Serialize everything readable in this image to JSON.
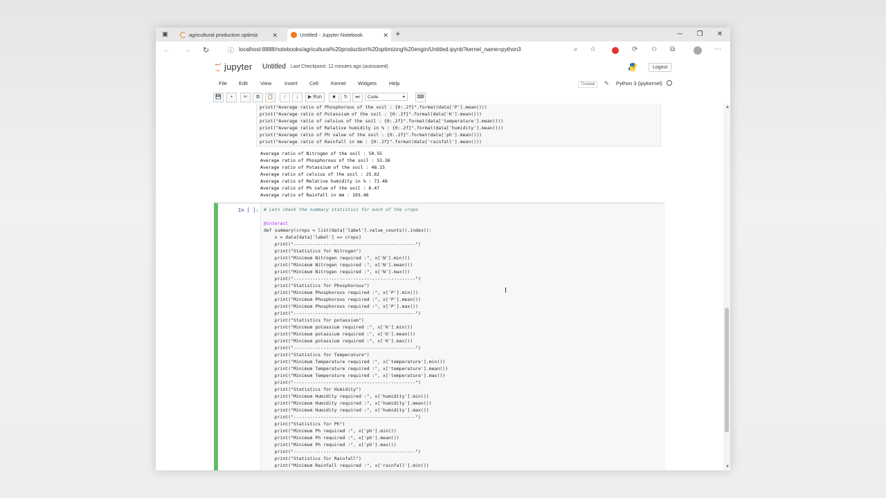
{
  "browser": {
    "tabs": [
      {
        "label": "agricultural production optimiz"
      },
      {
        "label": "Untitled - Jupyter Notebook"
      }
    ],
    "new_tab": "+",
    "url": "localhost:8888/notebooks/agricultural%20production%20optimizing%20engin/Untitled.ipynb?kernel_name=python3"
  },
  "jupyter": {
    "logo": "jupyter",
    "notebook_name": "Untitled",
    "checkpoint": "Last Checkpoint: 12 minutes ago  (autosaved)",
    "logout": "Logout",
    "menu": [
      "File",
      "Edit",
      "View",
      "Insert",
      "Cell",
      "Kernel",
      "Widgets",
      "Help"
    ],
    "trusted": "Trusted",
    "kernel": "Python 3 (ipykernel)",
    "toolbar": {
      "run": "Run",
      "cell_type": "Code"
    }
  },
  "cell1": {
    "code": [
      "print(\"Average ratio of Phosphorous of the soil : {0:.2f}\".format(data['P'].mean()))",
      "print(\"Average ratio of Potassium of the soil : {0:.2f}\".format(data['K'].mean()))",
      "print(\"Average ratio of celsius of the soil : {0:.2f}\".format(data['temperature'].mean()))",
      "print(\"Average ratio of Relative humidity in % : {0:.2f}\".format(data['humidity'].mean()))",
      "print(\"Average ratio of Ph value of the soil : {0:.2f}\".format(data['ph'].mean()))",
      "print(\"Average ratio of Rainfall in mm : {0:.2f}\".format(data['rainfall'].mean()))"
    ],
    "output": [
      "Average ratio of Nitrogen of the soil : 50.55",
      "Average ratio of Phosphorous of the soil : 53.36",
      "Average ratio of Potassium of the soil : 48.15",
      "Average ratio of celsius of the soil : 25.62",
      "Average ratio of Relative humidity in % : 71.48",
      "Average ratio of Ph value of the soil : 6.47",
      "Average ratio of Rainfall in mm : 103.46"
    ]
  },
  "cell2": {
    "prompt": "In [ ]:",
    "comment": "# Lets check the summary statistics for each of the crops",
    "code": [
      "",
      "@interact",
      "def summary(crops = list(data['label'].value_counts().index)):",
      "    x = data[data['label'] == crops]",
      "    print(\"---------------------------------------------\")",
      "    print(\"Statistics for Nitrogen\")",
      "    print(\"Minimum Nitrogen required :\", x['N'].min())",
      "    print(\"Minimum Nitrogen required :\", x['N'].mean())",
      "    print(\"Minimum Nitrogen required :\", x['N'].max())",
      "    print(\"---------------------------------------------\")",
      "    print(\"Statistics for Phosphorous\")",
      "    print(\"Minimum Phosphorous required :\", x['P'].min())",
      "    print(\"Minimum Phosphorous required :\", x['P'].mean())",
      "    print(\"Minimum Phosphorous required :\", x['P'].max())",
      "    print(\"---------------------------------------------\")",
      "    print(\"Statistics for potassium\")",
      "    print(\"Minimum potassium required :\", x['K'].min())",
      "    print(\"Minimum potassium required :\", x['K'].mean())",
      "    print(\"Minimum potassium required :\", x['K'].max())",
      "    print(\"---------------------------------------------\")",
      "    print(\"Statistics for Temperature\")",
      "    print(\"Minimum Temperature required :\", x['temperature'].min())",
      "    print(\"Minimum Temperature required :\", x['temperature'].mean())",
      "    print(\"Minimum Temperature required :\", x['temperature'].max())",
      "    print(\"---------------------------------------------\")",
      "    print(\"Statistics for Humidity\")",
      "    print(\"Minimum Humidity required :\", x['humidity'].min())",
      "    print(\"Minimum Humidity required :\", x['humidity'].mean())",
      "    print(\"Minimum Humidity required :\", x['humidity'].max())",
      "    print(\"---------------------------------------------\")",
      "    print(\"Statistics for Ph\")",
      "    print(\"Minimum Ph required :\", x['ph'].min())",
      "    print(\"Minimum Ph required :\", x['ph'].mean())",
      "    print(\"Minimum Ph required :\", x['ph'].max())",
      "    print(\"---------------------------------------------\")",
      "    print(\"Statistics for Rainfall\")",
      "    print(\"Minimum Rainfall required :\", x['rainfall'].min())"
    ]
  }
}
